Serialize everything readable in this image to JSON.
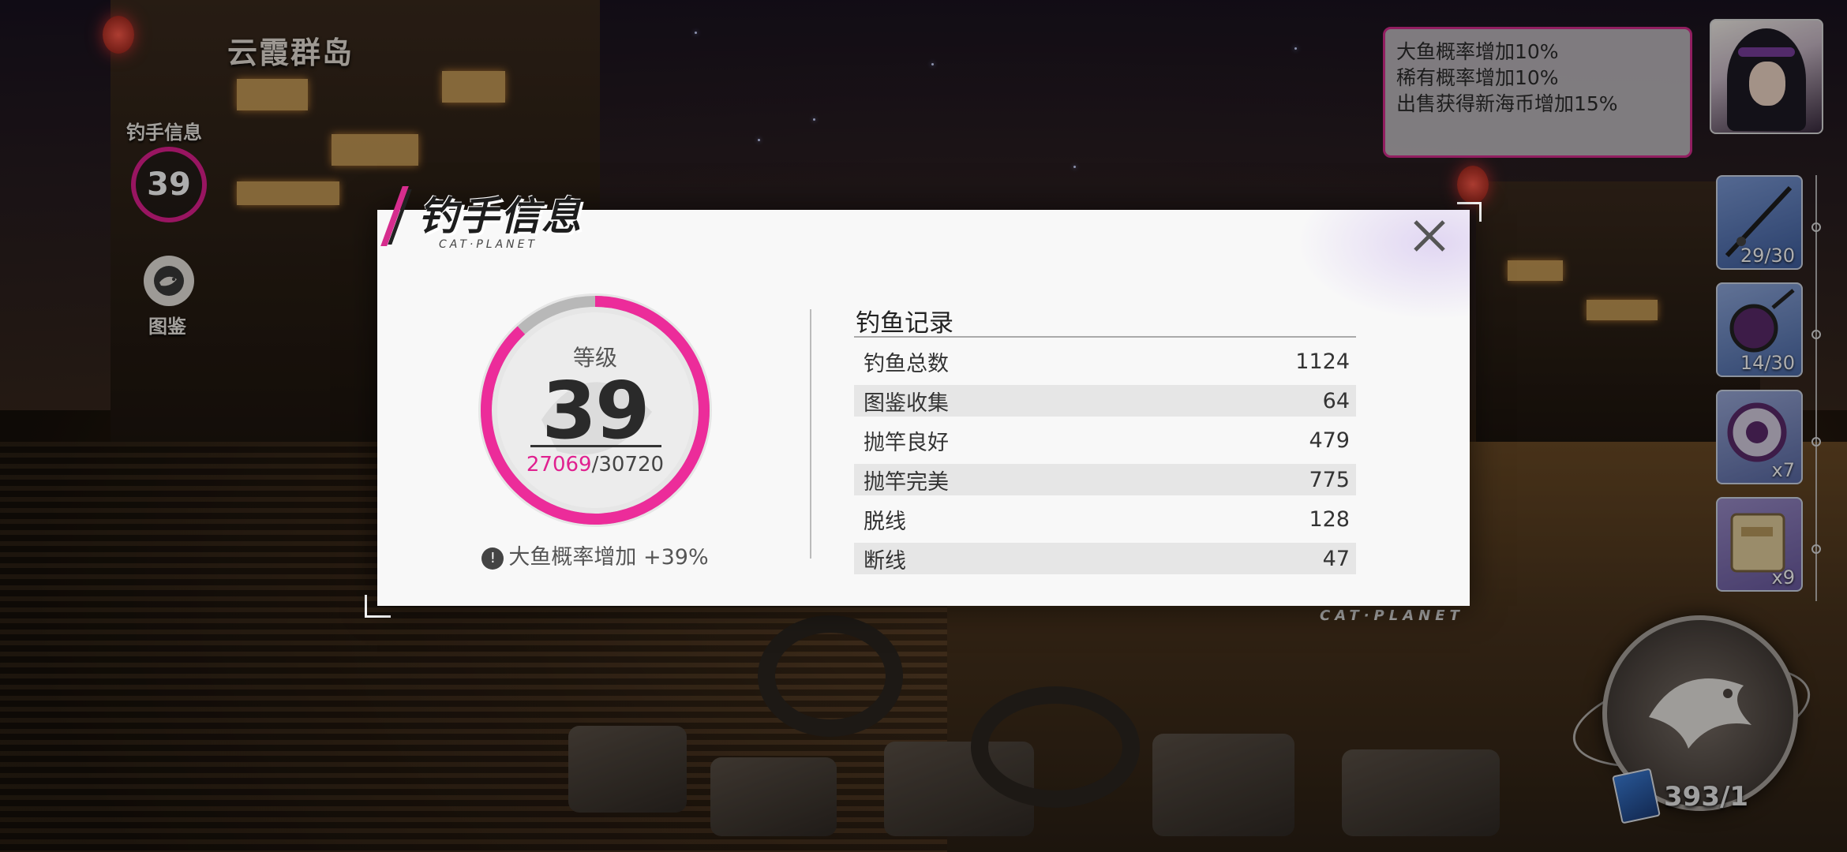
{
  "location": {
    "area_name": "云霞群岛"
  },
  "left_hud": {
    "angler_label": "钓手信息",
    "level": "39",
    "codex_label": "图鉴"
  },
  "buff_box": {
    "lines": [
      "大鱼概率增加10%",
      "稀有概率增加10%",
      "出售获得新海币增加15%"
    ]
  },
  "item_slots": [
    {
      "name": "fishing-rod",
      "count": "29/30"
    },
    {
      "name": "fishing-reel",
      "count": "14/30"
    },
    {
      "name": "fishing-line",
      "count": "x7"
    },
    {
      "name": "bait-pack",
      "count": "x9"
    }
  ],
  "bait": {
    "count": "393/1"
  },
  "brand": "CAT·PLANET",
  "modal": {
    "title": "钓手信息",
    "subtitle": "CAT·PLANET",
    "close_icon": "close-icon",
    "level_label": "等级",
    "level_value": "39",
    "xp_current": "27069",
    "xp_separator": "/",
    "xp_max": "30720",
    "xp_progress": 0.881,
    "bonus_text": "大鱼概率增加 +39%",
    "bonus_icon": "fish-alert-icon",
    "records_title": "钓鱼记录",
    "records": [
      {
        "label": "钓鱼总数",
        "value": "1124"
      },
      {
        "label": "图鉴收集",
        "value": "64"
      },
      {
        "label": "抛竿良好",
        "value": "479"
      },
      {
        "label": "抛竿完美",
        "value": "775"
      },
      {
        "label": "脱线",
        "value": "128"
      },
      {
        "label": "断线",
        "value": "47"
      }
    ]
  },
  "colors": {
    "accent": "#e0208f",
    "panel": "#f8f8f8"
  }
}
